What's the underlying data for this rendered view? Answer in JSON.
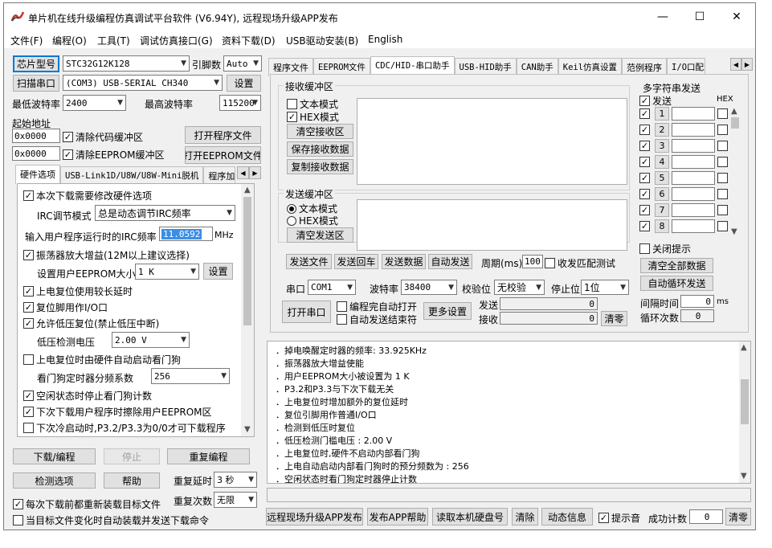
{
  "window": {
    "title": "单片机在线升级编程仿真调试平台软件 (V6.94Y), 远程现场升级APP发布",
    "min": "—",
    "max": "☐",
    "close": "✕"
  },
  "menu": [
    "文件(F)",
    "编程(O)",
    "工具(T)",
    "调试仿真接口(G)",
    "资料下载(D)",
    "USB驱动安装(B)",
    "English"
  ],
  "left": {
    "chip_btn": "芯片型号",
    "chip_val": "STC32G12K128",
    "pin_lbl": "引脚数",
    "pin_val": "Auto",
    "scan_btn": "扫描串口",
    "port_val": "(COM3) USB-SERIAL CH340",
    "settings_btn": "设置",
    "minbaud_lbl": "最低波特率",
    "minbaud_val": "2400",
    "maxbaud_lbl": "最高波特率",
    "maxbaud_val": "115200",
    "start_addr_lbl": "起始地址",
    "addr1": "0x0000",
    "clear_code": "清除代码缓冲区",
    "open_prog": "打开程序文件",
    "addr2": "0x0000",
    "clear_eeprom": "清除EEPROM缓冲区",
    "open_eeprom": "打开EEPROM文件",
    "tabs": [
      "硬件选项",
      "USB-Link1D/U8W/U8W-Mini脱机",
      "程序加"
    ],
    "opts": {
      "o1": "本次下载需要修改硬件选项",
      "irc_lbl": "IRC调节模式",
      "irc_val": "总是动态调节IRC频率",
      "freq_lbl": "输入用户程序运行时的IRC频率",
      "freq_val": "11.0592",
      "freq_unit": "MHz",
      "o2": "振荡器放大增益(12M以上建议选择)",
      "eeprom_lbl": "设置用户EEPROM大小",
      "eeprom_val": "1  K",
      "eeprom_btn": "设置",
      "o3": "上电复位使用较长延时",
      "o4": "复位脚用作I/O口",
      "o5": "允许低压复位(禁止低压中断)",
      "lv_lbl": "低压检测电压",
      "lv_val": "2.00 V",
      "o6": "上电复位时由硬件自动启动看门狗",
      "wdt_lbl": "看门狗定时器分频系数",
      "wdt_val": "256",
      "o7": "空闲状态时停止看门狗计数",
      "o8": "下次下载用户程序时擦除用户EEPROM区",
      "o9": "下次冷启动时,P3.2/P3.3为0/0才可下载程序"
    },
    "download_btn": "下载/编程",
    "stop_btn": "停止",
    "redo_btn": "重复编程",
    "check_btn": "检测选项",
    "help_btn": "帮助",
    "delay_lbl": "重复延时",
    "delay_val": "3 秒",
    "count_lbl": "重复次数",
    "count_val": "无限",
    "reload_cb": "每次下载前都重新装载目标文件",
    "auto_cb": "当目标文件变化时自动装载并发送下载命令"
  },
  "right": {
    "tabs": [
      "程序文件",
      "EEPROM文件",
      "CDC/HID-串口助手",
      "USB-HID助手",
      "CAN助手",
      "Keil仿真设置",
      "范例程序",
      "I/O口配置"
    ],
    "rx_group": "接收缓冲区",
    "rx_text": "文本模式",
    "rx_hex": "HEX模式",
    "rx_clear": "清空接收区",
    "rx_save": "保存接收数据",
    "rx_copy": "复制接收数据",
    "tx_group": "发送缓冲区",
    "tx_text": "文本模式",
    "tx_hex": "HEX模式",
    "tx_clear": "清空发送区",
    "send_file": "发送文件",
    "send_cr": "发送回车",
    "send_data": "发送数据",
    "auto_send": "自动发送",
    "period_lbl": "周期(ms)",
    "period_val": "100",
    "match_lbl": "收发匹配测试",
    "multi_group": "多字符串发送",
    "send_hdr": "发送",
    "hex_hdr": "HEX",
    "rows": [
      "1",
      "2",
      "3",
      "4",
      "5",
      "6",
      "7",
      "8"
    ],
    "close_tip": "关闭提示",
    "clear_all": "清空全部数据",
    "auto_loop": "自动循环发送",
    "interval_lbl": "间隔时间",
    "interval_val": "0",
    "interval_unit": "ms",
    "loop_lbl": "循环次数",
    "loop_val": "0",
    "port_lbl": "串口",
    "port_val": "COM1",
    "baud_lbl": "波特率",
    "baud_val": "38400",
    "parity_lbl": "校验位",
    "parity_val": "无校验",
    "stop_lbl": "停止位",
    "stop_val": "1位",
    "open_port": "打开串口",
    "auto_open": "编程完自动打开",
    "auto_end": "自动发送结束符",
    "more_btn": "更多设置",
    "sent_lbl": "发送",
    "sent_val": "0",
    "recv_lbl": "接收",
    "recv_val": "0",
    "clear_btn": "清零"
  },
  "log": [
    "．掉电唤醒定时器的频率: 33.925KHz",
    "．振荡器放大增益使能",
    "．用户EEPROM大小被设置为 1 K",
    "．P3.2和P3.3与下次下载无关",
    "．上电复位时增加额外的复位延时",
    "．复位引脚用作普通I/O口",
    "．检测到低压时复位",
    "．低压检测门槛电压 : 2.00 V",
    "．上电复位时,硬件不启动内部看门狗",
    "．上电自动启动内部看门狗时的预分频数为 : 256",
    "．空闲状态时看门狗定时器停止计数"
  ],
  "bottom": {
    "b1": "远程现场升级APP发布",
    "b2": "发布APP帮助",
    "b3": "读取本机硬盘号",
    "b4": "清除",
    "b5": "动态信息",
    "beep": "提示音",
    "succ_lbl": "成功计数",
    "succ_val": "0",
    "zero": "清零"
  }
}
